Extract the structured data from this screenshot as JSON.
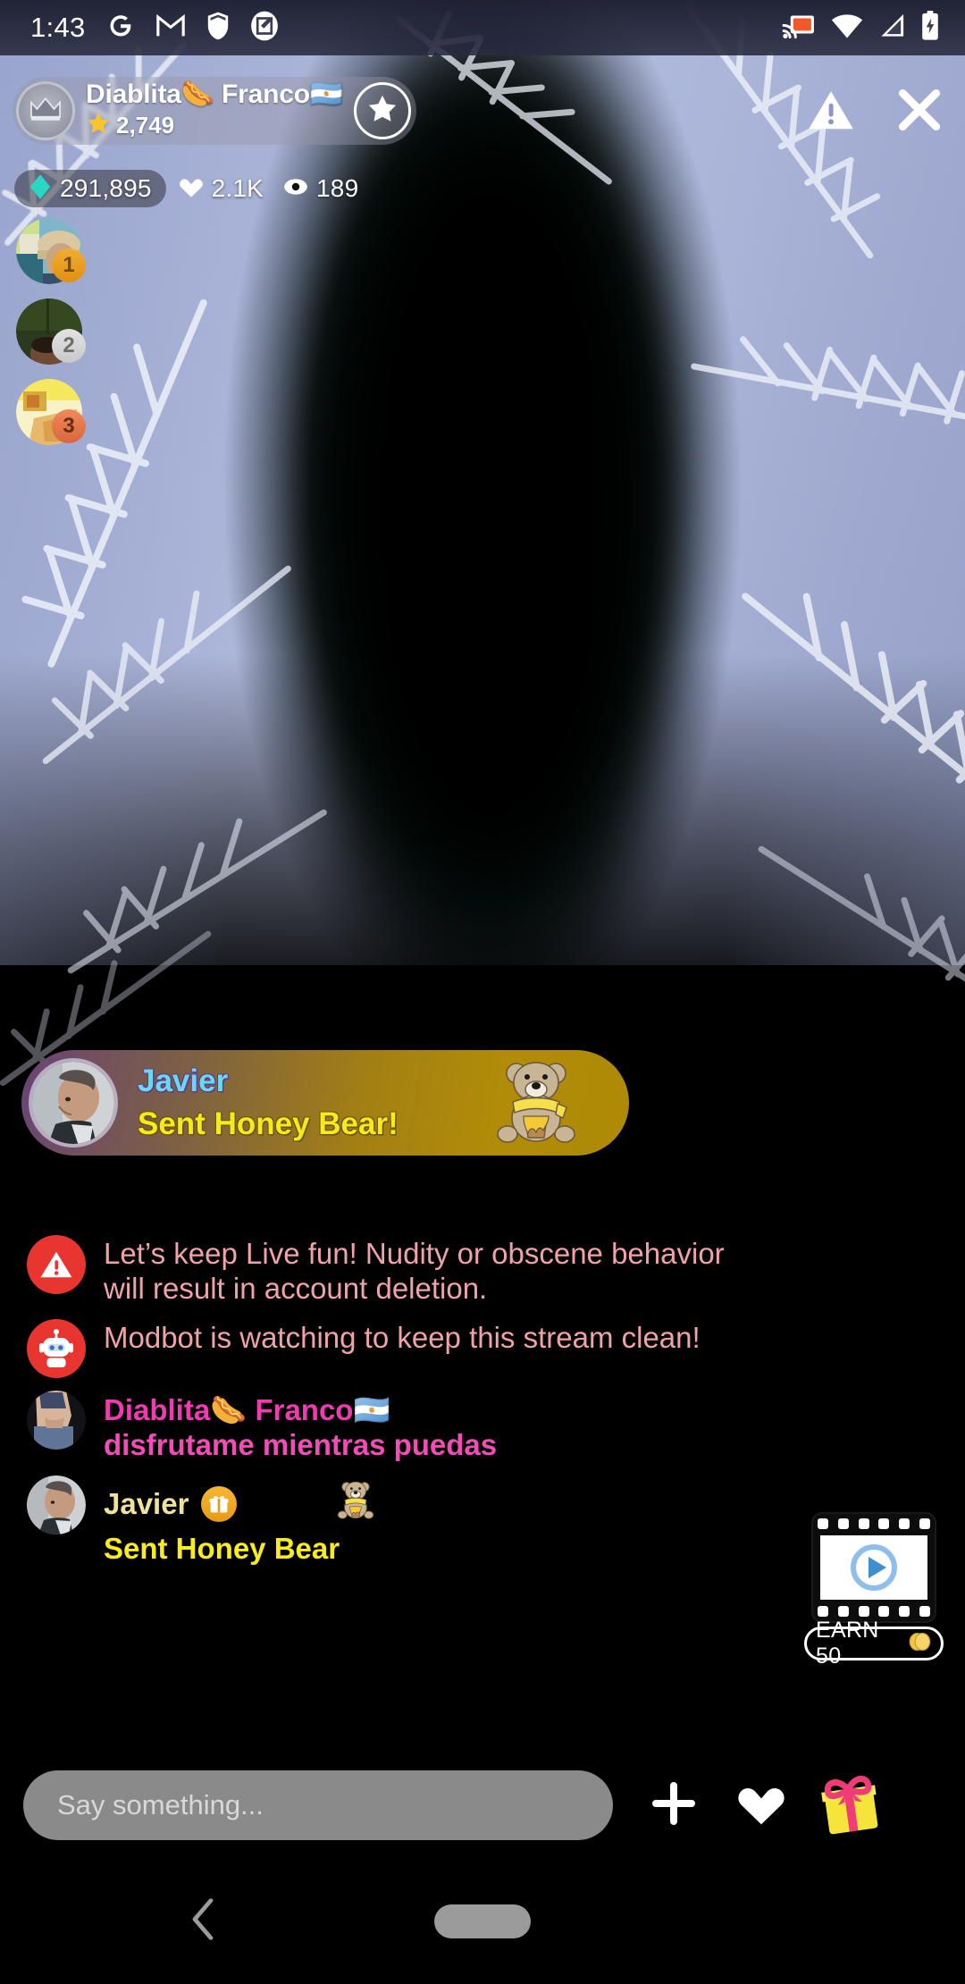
{
  "statusbar": {
    "time": "1:43",
    "left_icons": [
      "google-icon",
      "gmail-icon",
      "shield-icon",
      "note-icon"
    ],
    "right_icons": [
      "cast-icon",
      "wifi-icon",
      "cellular-signal-icon",
      "battery-charging-icon"
    ],
    "cast_color": "#f05a28"
  },
  "header": {
    "host_name": "Diablita🌭 Franco🇦🇷",
    "star_count": "2,749",
    "star_icon": "star-icon",
    "avatar_icon": "crown-icon",
    "follow_icon": "star-icon",
    "report_icon": "warning-triangle-icon",
    "close_icon": "close-icon"
  },
  "stats": {
    "diamonds": "291,895",
    "diamond_icon": "diamond-icon",
    "diamond_color": "#2ad6c4",
    "likes": "2.1K",
    "like_icon": "heart-icon",
    "viewers": "189",
    "viewer_icon": "eye-icon"
  },
  "leaderboard": [
    {
      "rank": "1",
      "name": "top-viewer-1",
      "badge_color": "#e69a14"
    },
    {
      "rank": "2",
      "name": "top-viewer-2",
      "badge_color": "#cfcfcf"
    },
    {
      "rank": "3",
      "name": "top-viewer-3",
      "badge_color": "#df7448"
    }
  ],
  "gift_banner": {
    "sender": "Javier",
    "action": "Sent Honey Bear!",
    "gift_icon": "honey-bear-icon",
    "sender_color": "#6cd8f0",
    "action_color": "#f5ea1a"
  },
  "chat": [
    {
      "type": "system-warning",
      "icon": "warning-circle-icon",
      "text": "Let’s keep Live fun! Nudity or obscene behavior will result in account deletion."
    },
    {
      "type": "system-modbot",
      "icon": "robot-icon",
      "text": "Modbot is watching to keep this stream clean!"
    },
    {
      "type": "user-message",
      "icon": "user-avatar",
      "name": "Diablita🌭 Franco🇦🇷",
      "text": "disfrutame mientras puedas"
    },
    {
      "type": "gift-message",
      "icon": "user-avatar",
      "name": "Javier",
      "badge_icon": "gift-badge-icon",
      "text": "Sent Honey Bear",
      "gift_icon": "honey-bear-icon"
    }
  ],
  "earn_widget": {
    "icon": "video-film-play-icon",
    "label": "EARN 50",
    "coin_icon": "coin-icon"
  },
  "bottom_bar": {
    "input_placeholder": "Say something...",
    "input_value": "",
    "plus_icon": "plus-icon",
    "heart_icon": "heart-icon",
    "gift_icon": "gift-box-icon"
  },
  "navbar": {
    "back_icon": "back-chevron-icon",
    "home_icon": "home-pill-icon"
  }
}
